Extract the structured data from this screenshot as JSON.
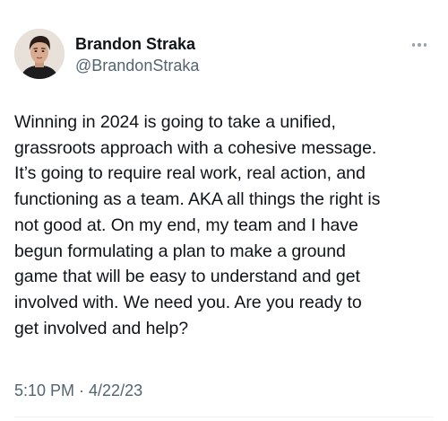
{
  "user": {
    "display_name": "Brandon Straka",
    "handle": "@BrandonStraka"
  },
  "icons": {
    "more": "more-horizontal-icon",
    "avatar": "profile-photo"
  },
  "tweet": {
    "text": "Winning in 2024 is going to take a unified,\ngrassroots approach with a cohesive message.\nIt’s going to require real work, real action, and\nfunctioning as a team. AKA all things the right is\nnot good at. On my end, my team and I have\nbegun formulating a plan to make a ground\ngame that will be easy to understand and get\ninvolved with. We need you. Are you ready to\nget involved and help?",
    "timestamp": "5:10 PM · 4/22/23"
  }
}
